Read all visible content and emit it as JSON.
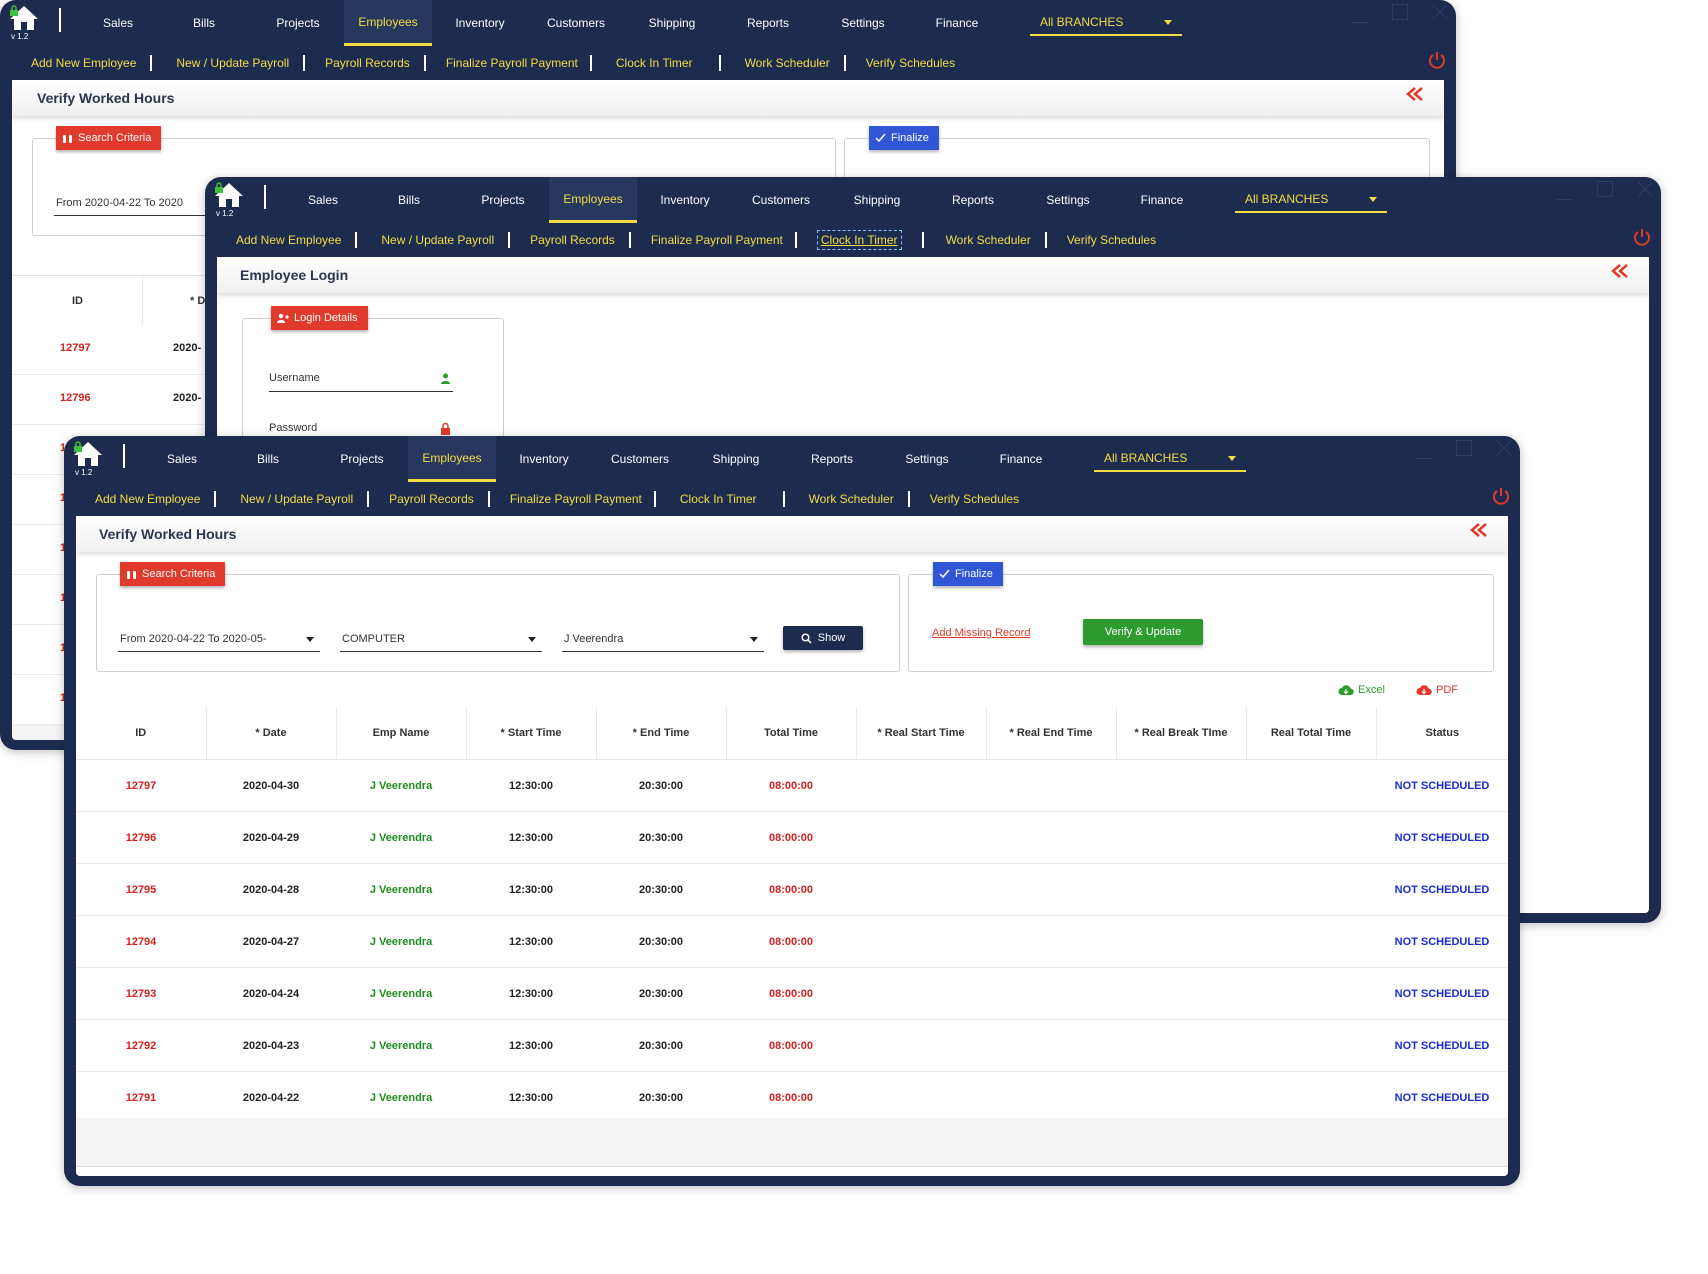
{
  "version": "v 1.2",
  "menu": [
    "Sales",
    "Bills",
    "Projects",
    "Employees",
    "Inventory",
    "Customers",
    "Shipping",
    "Reports",
    "Settings",
    "Finance"
  ],
  "active_menu": "Employees",
  "branch": "All BRANCHES",
  "submenu": [
    "Add New Employee",
    "New / Update Payroll",
    "Payroll Records",
    "Finalize Payroll Payment",
    "Clock In Timer",
    "Work Scheduler",
    "Verify Schedules"
  ],
  "colors": {
    "navy": "#1d2b4f",
    "yellow": "#f3dc42",
    "red": "#e03a2c",
    "green": "#2e9b2e",
    "blue": "#1a2ad6"
  },
  "back_window": {
    "title": "Verify Worked Hours",
    "search_badge": "Search Criteria",
    "finalize_badge": "Finalize",
    "date_range": "From 2020-04-22 To 2020",
    "col_id": "ID",
    "col_date_partial": "* D",
    "rows": [
      {
        "id": "12797",
        "date": "2020-"
      },
      {
        "id": "12796",
        "date": "2020-"
      }
    ],
    "partial_ids": [
      "1",
      "1",
      "1",
      "1",
      "1",
      "1"
    ]
  },
  "login_window": {
    "title": "Employee Login",
    "badge": "Login Details",
    "username_label": "Username",
    "password_label": "Password"
  },
  "front_window": {
    "title": "Verify Worked Hours",
    "search_badge": "Search Criteria",
    "finalize_badge": "Finalize",
    "date_range": "From 2020-04-22 To 2020-05-",
    "department": "COMPUTER",
    "employee": "J Veerendra",
    "show_button": "Show",
    "add_missing": "Add Missing Record",
    "verify_button": "Verify & Update",
    "excel": "Excel",
    "pdf": "PDF",
    "columns": [
      "ID",
      "* Date",
      "Emp Name",
      "* Start Time",
      "* End Time",
      "Total Time",
      "* Real Start Time",
      "* Real End Time",
      "* Real Break TIme",
      "Real Total Time",
      "Status"
    ],
    "rows": [
      {
        "id": "12797",
        "date": "2020-04-30",
        "emp": "J Veerendra",
        "start": "12:30:00",
        "end": "20:30:00",
        "total": "08:00:00",
        "status": "NOT SCHEDULED"
      },
      {
        "id": "12796",
        "date": "2020-04-29",
        "emp": "J Veerendra",
        "start": "12:30:00",
        "end": "20:30:00",
        "total": "08:00:00",
        "status": "NOT SCHEDULED"
      },
      {
        "id": "12795",
        "date": "2020-04-28",
        "emp": "J Veerendra",
        "start": "12:30:00",
        "end": "20:30:00",
        "total": "08:00:00",
        "status": "NOT SCHEDULED"
      },
      {
        "id": "12794",
        "date": "2020-04-27",
        "emp": "J Veerendra",
        "start": "12:30:00",
        "end": "20:30:00",
        "total": "08:00:00",
        "status": "NOT SCHEDULED"
      },
      {
        "id": "12793",
        "date": "2020-04-24",
        "emp": "J Veerendra",
        "start": "12:30:00",
        "end": "20:30:00",
        "total": "08:00:00",
        "status": "NOT SCHEDULED"
      },
      {
        "id": "12792",
        "date": "2020-04-23",
        "emp": "J Veerendra",
        "start": "12:30:00",
        "end": "20:30:00",
        "total": "08:00:00",
        "status": "NOT SCHEDULED"
      },
      {
        "id": "12791",
        "date": "2020-04-22",
        "emp": "J Veerendra",
        "start": "12:30:00",
        "end": "20:30:00",
        "total": "08:00:00",
        "status": "NOT SCHEDULED"
      }
    ]
  }
}
